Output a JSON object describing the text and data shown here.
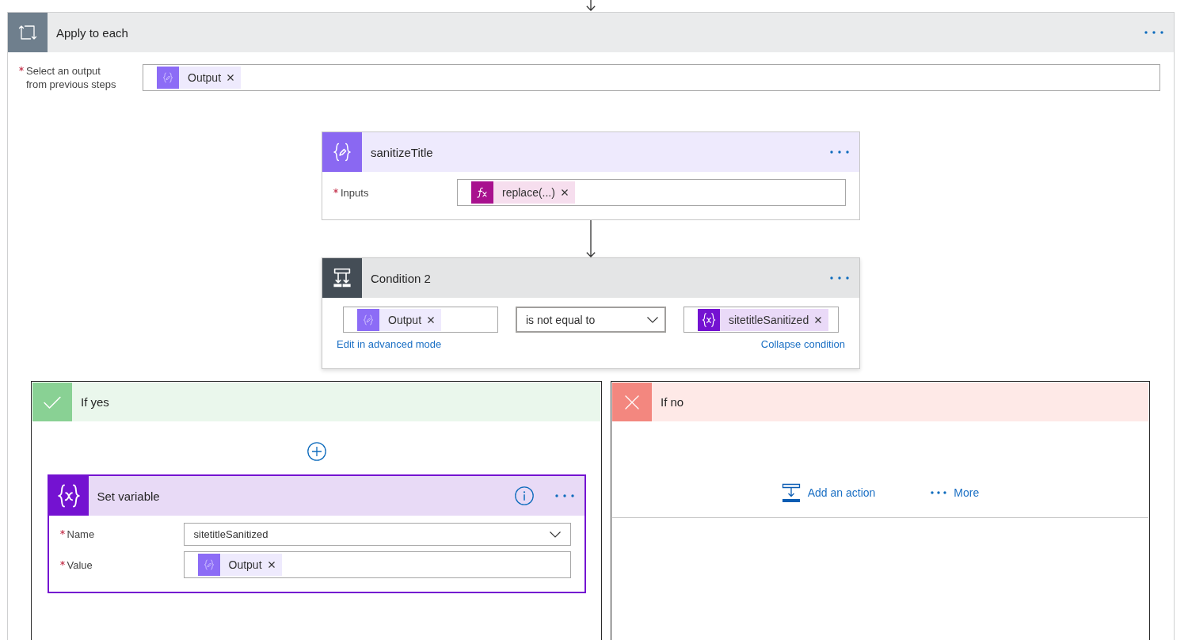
{
  "loop": {
    "kind": "loop",
    "title": "Apply to each",
    "field": {
      "label": "Select an output from previous steps",
      "required": true,
      "kind": "tokens",
      "tokens": [
        {
          "kind": "output",
          "text": "Output"
        }
      ]
    }
  },
  "actions": [
    {
      "kind": "compose",
      "title": "sanitizeTitle",
      "selected": false,
      "fields": [
        {
          "label": "Inputs",
          "required": true,
          "kind": "tokens",
          "tokens": [
            {
              "kind": "expression",
              "text": "replace(...)"
            }
          ]
        }
      ]
    }
  ],
  "condition": {
    "kind": "condition",
    "title": "Condition 2",
    "left": {
      "tokens": [
        {
          "kind": "output",
          "text": "Output"
        }
      ]
    },
    "operator": "is not equal to",
    "right": {
      "tokens": [
        {
          "kind": "variable",
          "text": "sitetitleSanitized"
        }
      ]
    },
    "links": [
      "Edit in advanced mode",
      "Collapse condition"
    ]
  },
  "branches": [
    {
      "kind": "yes",
      "title": "If yes",
      "actions": [
        {
          "kind": "set_variable",
          "title": "Set variable",
          "selected": true,
          "fields": [
            {
              "label": "Name",
              "required": true,
              "kind": "dropdown",
              "value": "sitetitleSanitized"
            },
            {
              "label": "Value",
              "required": true,
              "kind": "tokens",
              "tokens": [
                {
                  "kind": "output",
                  "text": "Output"
                }
              ]
            }
          ]
        }
      ]
    },
    {
      "kind": "no",
      "title": "If no",
      "buttons": [
        {
          "kind": "add_action",
          "label": "Add an action"
        },
        {
          "kind": "more",
          "label": "More"
        }
      ]
    }
  ]
}
